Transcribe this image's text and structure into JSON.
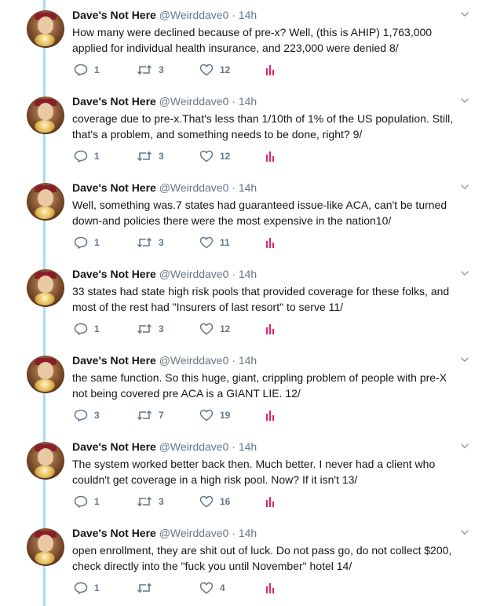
{
  "author": {
    "name": "Dave's Not Here",
    "handle": "@Weirddave0",
    "separator": "·"
  },
  "colors": {
    "thread_line": "#a9dbf6",
    "secondary_text": "#657786",
    "primary_text": "#14171a"
  },
  "icons": {
    "reply": "reply-icon",
    "retweet": "retweet-icon",
    "like": "heart-icon",
    "analytics": "analytics-icon",
    "menu": "chevron-down-icon"
  },
  "tweets": [
    {
      "time": "14h",
      "text": "How many were declined because of pre-x? Well, (this is AHIP) 1,763,000 applied for individual health insurance, and 223,000 were denied 8/",
      "replies": "1",
      "retweets": "3",
      "likes": "12"
    },
    {
      "time": "14h",
      "text": "coverage due to pre-x.That's less than 1/10th of 1% of the US population. Still, that's a problem, and something needs to be done, right? 9/",
      "replies": "1",
      "retweets": "3",
      "likes": "12"
    },
    {
      "time": "14h",
      "text": "Well, something was.7 states had guaranteed issue-like ACA, can't be turned down-and policies there were the most expensive in the nation10/",
      "replies": "1",
      "retweets": "3",
      "likes": "11"
    },
    {
      "time": "14h",
      "text": "33 states had state high risk pools that provided coverage for these folks, and most of the rest had \"Insurers of last resort\" to serve 11/",
      "replies": "1",
      "retweets": "3",
      "likes": "12"
    },
    {
      "time": "14h",
      "text": "the same function. So this huge, giant, crippling problem of people with pre-X not being covered pre ACA is a GIANT LIE. 12/",
      "replies": "3",
      "retweets": "7",
      "likes": "19"
    },
    {
      "time": "14h",
      "text": "The system worked better back then. Much better. I never had a client who couldn't get coverage in a high risk pool. Now? If it isn't 13/",
      "replies": "1",
      "retweets": "3",
      "likes": "16"
    },
    {
      "time": "14h",
      "text": "open enrollment, they are shit out of luck. Do not pass go, do not collect $200, check directly into the \"fuck you until November\" hotel 14/",
      "replies": "1",
      "retweets": "",
      "likes": "4"
    }
  ]
}
